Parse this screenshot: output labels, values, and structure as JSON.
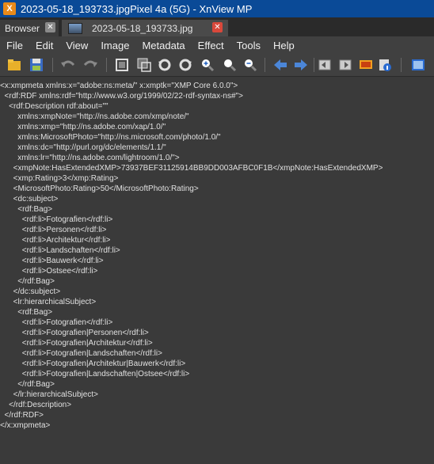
{
  "window": {
    "title": "2023-05-18_193733.jpgPixel 4a (5G) - XnView MP"
  },
  "tabs": [
    {
      "label": "Browser"
    },
    {
      "label": "2023-05-18_193733.jpg"
    }
  ],
  "menu": [
    "File",
    "Edit",
    "View",
    "Image",
    "Metadata",
    "Effect",
    "Tools",
    "Help"
  ],
  "colors": {
    "titlebar": "#0a4a97",
    "background": "#3a3a3a",
    "toolbar": "#404040",
    "close_active": "#d9483b"
  },
  "toolbar_icons": [
    "folder-icon",
    "save-icon",
    "undo-icon",
    "redo-icon",
    "crop-icon",
    "resize-icon",
    "rotate-left-icon",
    "rotate-right-icon",
    "zoom-in-icon",
    "zoom-fit-icon",
    "zoom-out-icon",
    "prev-icon",
    "next-icon",
    "prev-page-icon",
    "next-page-icon",
    "slideshow-icon",
    "info-icon",
    "fullscreen-icon"
  ],
  "xmp_lines": [
    "<x:xmpmeta xmlns:x=\"adobe:ns:meta/\" x:xmptk=\"XMP Core 6.0.0\">",
    "  <rdf:RDF xmlns:rdf=\"http://www.w3.org/1999/02/22-rdf-syntax-ns#\">",
    "    <rdf:Description rdf:about=\"\"",
    "        xmlns:xmpNote=\"http://ns.adobe.com/xmp/note/\"",
    "        xmlns:xmp=\"http://ns.adobe.com/xap/1.0/\"",
    "        xmlns:MicrosoftPhoto=\"http://ns.microsoft.com/photo/1.0/\"",
    "        xmlns:dc=\"http://purl.org/dc/elements/1.1/\"",
    "        xmlns:lr=\"http://ns.adobe.com/lightroom/1.0/\">",
    "      <xmpNote:HasExtendedXMP>73937BEF31125914BB9DD003AFBC0F1B</xmpNote:HasExtendedXMP>",
    "      <xmp:Rating>3</xmp:Rating>",
    "      <MicrosoftPhoto:Rating>50</MicrosoftPhoto:Rating>",
    "      <dc:subject>",
    "        <rdf:Bag>",
    "          <rdf:li>Fotografien</rdf:li>",
    "          <rdf:li>Personen</rdf:li>",
    "          <rdf:li>Architektur</rdf:li>",
    "          <rdf:li>Landschaften</rdf:li>",
    "          <rdf:li>Bauwerk</rdf:li>",
    "          <rdf:li>Ostsee</rdf:li>",
    "        </rdf:Bag>",
    "      </dc:subject>",
    "      <lr:hierarchicalSubject>",
    "        <rdf:Bag>",
    "          <rdf:li>Fotografien</rdf:li>",
    "          <rdf:li>Fotografien|Personen</rdf:li>",
    "          <rdf:li>Fotografien|Architektur</rdf:li>",
    "          <rdf:li>Fotografien|Landschaften</rdf:li>",
    "          <rdf:li>Fotografien|Architektur|Bauwerk</rdf:li>",
    "          <rdf:li>Fotografien|Landschaften|Ostsee</rdf:li>",
    "        </rdf:Bag>",
    "      </lr:hierarchicalSubject>",
    "    </rdf:Description>",
    "  </rdf:RDF>",
    "</x:xmpmeta>"
  ]
}
